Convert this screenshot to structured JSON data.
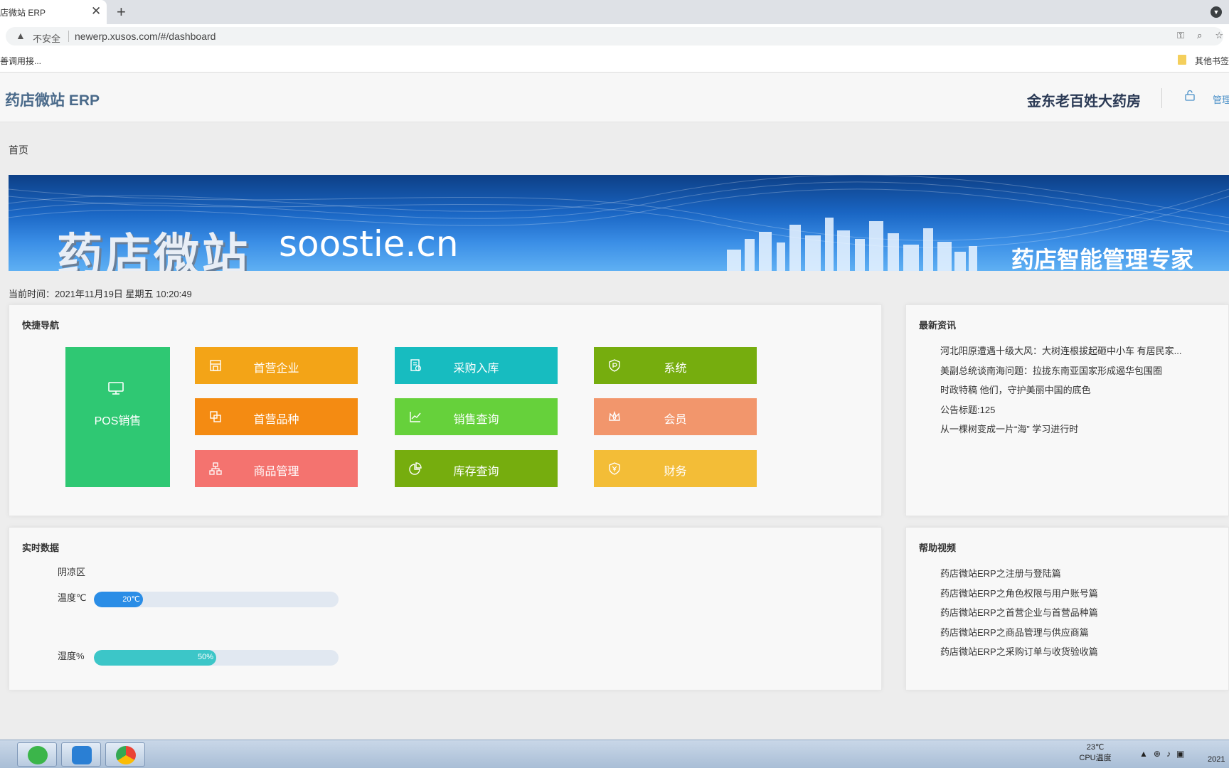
{
  "browser": {
    "tab_title": "店微站 ERP",
    "insecure_label": "不安全",
    "url": "newerp.xusos.com/#/dashboard",
    "bookmark_left": "善调用接...",
    "bookmark_right": "其他书签"
  },
  "header": {
    "app_title": "药店微站 ERP",
    "store_name": "金东老百姓大药房",
    "admin_label": "管理"
  },
  "breadcrumb": "首页",
  "banner": {
    "brand": "药店微站",
    "url_text": "soostie.cn",
    "slogan": "药店智能管理专家"
  },
  "current_time": {
    "label": "当前时间：",
    "value": "2021年11月19日 星期五 10:20:49"
  },
  "quick_nav": {
    "title": "快捷导航",
    "pos": {
      "label": "POS销售",
      "color": "#2fc873"
    },
    "tiles": [
      {
        "label": "首营企业",
        "color": "#f3a417",
        "icon": "store-icon"
      },
      {
        "label": "采购入库",
        "color": "#17bcc0",
        "icon": "document-check-icon"
      },
      {
        "label": "系统",
        "color": "#76ad0e",
        "icon": "shield-p-icon"
      },
      {
        "label": "首营品种",
        "color": "#f48b12",
        "icon": "copy-icon"
      },
      {
        "label": "销售查询",
        "color": "#66d13b",
        "icon": "line-chart-icon"
      },
      {
        "label": "会员",
        "color": "#f2966c",
        "icon": "crown-icon"
      },
      {
        "label": "商品管理",
        "color": "#f4736f",
        "icon": "sitemap-icon"
      },
      {
        "label": "库存查询",
        "color": "#76ad0e",
        "icon": "pie-chart-icon"
      },
      {
        "label": "财务",
        "color": "#f3bd37",
        "icon": "shield-money-icon"
      }
    ]
  },
  "news": {
    "title": "最新资讯",
    "items": [
      "河北阳原遭遇十级大风：大树连根拔起砸中小车 有居民家...",
      "美副总统谈南海问题：拉拢东南亚国家形成遏华包围圈",
      "时政特稿 他们，守护美丽中国的底色",
      "公告标题:125",
      "从一棵树变成一片“海” 学习进行时"
    ]
  },
  "realtime": {
    "title": "实时数据",
    "area": "阴凉区",
    "temp_label": "温度℃",
    "temp_text": "20℃",
    "temp_fraction": 0.2,
    "temp_color": "#2a8de6",
    "humidity_label": "湿度%",
    "humidity_text": "50%",
    "humidity_fraction": 0.5,
    "humidity_color": "#3cc6c8"
  },
  "help": {
    "title": "帮助视频",
    "items": [
      "药店微站ERP之注册与登陆篇",
      "药店微站ERP之角色权限与用户账号篇",
      "药店微站ERP之首营企业与首营品种篇",
      "药店微站ERP之商品管理与供应商篇",
      "药店微站ERP之采购订单与收货验收篇"
    ]
  },
  "taskbar": {
    "temp_value": "23℃",
    "temp_label": "CPU温度",
    "clock": "2021"
  }
}
